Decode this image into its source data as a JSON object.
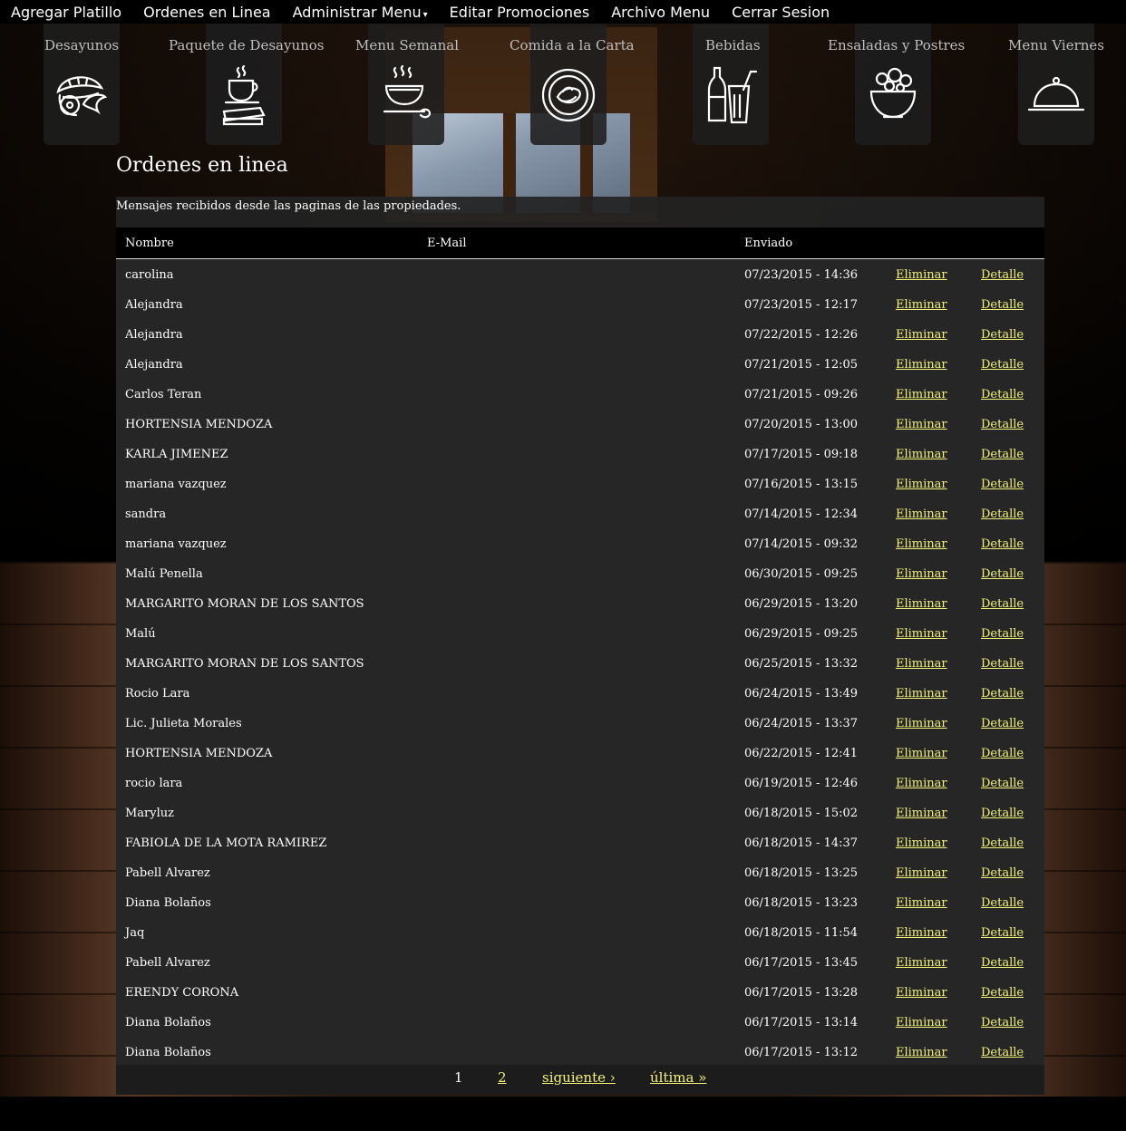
{
  "topnav": {
    "items": [
      "Agregar Platillo",
      "Ordenes en Linea",
      "Administrar Menu",
      "Editar Promociones",
      "Archivo Menu",
      "Cerrar Sesion"
    ],
    "admin_caret": "▾"
  },
  "categories": [
    {
      "label": "Desayunos",
      "icon": "pastry-icon"
    },
    {
      "label": "Paquete de Desayunos",
      "icon": "coffee-sandwich-icon"
    },
    {
      "label": "Menu Semanal",
      "icon": "soup-bowl-icon"
    },
    {
      "label": "Comida a la Carta",
      "icon": "plate-icon"
    },
    {
      "label": "Bebidas",
      "icon": "drinks-icon"
    },
    {
      "label": "Ensaladas y Postres",
      "icon": "salad-bowl-icon"
    },
    {
      "label": "Menu Viernes",
      "icon": "cloche-icon"
    }
  ],
  "page": {
    "title": "Ordenes en linea",
    "subtitle": "Mensajes recibidos desde las paginas de las propiedades."
  },
  "table": {
    "headers": {
      "name": "Nombre",
      "email": "E-Mail",
      "sent": "Enviado"
    },
    "delete_label": "Eliminar",
    "detail_label": "Detalle",
    "rows": [
      {
        "name": "carolina",
        "sent": "07/23/2015 - 14:36"
      },
      {
        "name": "Alejandra",
        "sent": "07/23/2015 - 12:17"
      },
      {
        "name": "Alejandra",
        "sent": "07/22/2015 - 12:26"
      },
      {
        "name": "Alejandra",
        "sent": "07/21/2015 - 12:05"
      },
      {
        "name": "Carlos Teran",
        "sent": "07/21/2015 - 09:26"
      },
      {
        "name": "HORTENSIA MENDOZA",
        "sent": "07/20/2015 - 13:00"
      },
      {
        "name": "KARLA JIMENEZ",
        "sent": "07/17/2015 - 09:18"
      },
      {
        "name": "mariana vazquez",
        "sent": "07/16/2015 - 13:15"
      },
      {
        "name": "sandra",
        "sent": "07/14/2015 - 12:34"
      },
      {
        "name": "mariana vazquez",
        "sent": "07/14/2015 - 09:32"
      },
      {
        "name": "Malú Penella",
        "sent": "06/30/2015 - 09:25"
      },
      {
        "name": "MARGARITO MORAN DE LOS SANTOS",
        "sent": "06/29/2015 - 13:20"
      },
      {
        "name": "Malú",
        "sent": "06/29/2015 - 09:25"
      },
      {
        "name": "MARGARITO MORAN DE LOS SANTOS",
        "sent": "06/25/2015 - 13:32"
      },
      {
        "name": "Rocio Lara",
        "sent": "06/24/2015 - 13:49"
      },
      {
        "name": "Lic. Julieta Morales",
        "sent": "06/24/2015 - 13:37"
      },
      {
        "name": "HORTENSIA MENDOZA",
        "sent": "06/22/2015 - 12:41"
      },
      {
        "name": "rocio lara",
        "sent": "06/19/2015 - 12:46"
      },
      {
        "name": "Maryluz",
        "sent": "06/18/2015 - 15:02"
      },
      {
        "name": "FABIOLA DE LA MOTA RAMIREZ",
        "sent": "06/18/2015 - 14:37"
      },
      {
        "name": "Pabell Alvarez",
        "sent": "06/18/2015 - 13:25"
      },
      {
        "name": "Diana Bolaños",
        "sent": "06/18/2015 - 13:23"
      },
      {
        "name": "Jaq",
        "sent": "06/18/2015 - 11:54"
      },
      {
        "name": "Pabell Alvarez",
        "sent": "06/17/2015 - 13:45"
      },
      {
        "name": "ERENDY CORONA",
        "sent": "06/17/2015 - 13:28"
      },
      {
        "name": "Diana Bolaños",
        "sent": "06/17/2015 - 13:14"
      },
      {
        "name": "Diana Bolaños",
        "sent": "06/17/2015 - 13:12"
      }
    ]
  },
  "pager": {
    "current": "1",
    "page2": "2",
    "next": "siguiente ›",
    "last": "última »"
  },
  "colors": {
    "link": "#f2f27a",
    "panel": "#262626",
    "header": "#000000"
  }
}
